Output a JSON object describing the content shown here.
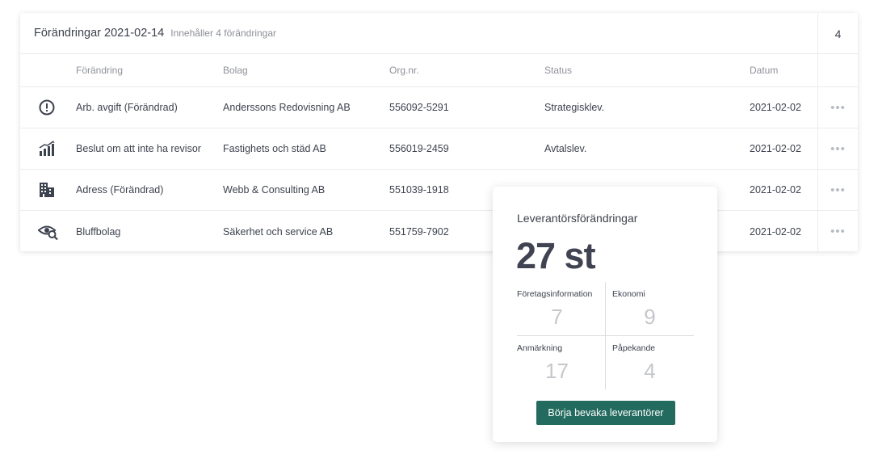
{
  "header": {
    "title": "Förändringar 2021-02-14",
    "subtitle": "Innehåller 4 förändringar",
    "count": "4"
  },
  "columns": {
    "change": "Förändring",
    "company": "Bolag",
    "org": "Org.nr.",
    "status": "Status",
    "date": "Datum"
  },
  "rows": [
    {
      "icon": "alert-circle-icon",
      "change": "Arb. avgift (Förändrad)",
      "company": "Anderssons Redovisning AB",
      "org": "556092-5291",
      "status": "Strategisklev.",
      "date": "2021-02-02",
      "more": "•••"
    },
    {
      "icon": "growth-chart-icon",
      "change": "Beslut om att inte ha revisor",
      "company": "Fastighets och städ AB",
      "org": "556019-2459",
      "status": "Avtalslev.",
      "date": "2021-02-02",
      "more": "•••"
    },
    {
      "icon": "buildings-icon",
      "change": "Adress (Förändrad)",
      "company": "Webb & Consulting AB",
      "org": "551039-1918",
      "status": "",
      "date": "2021-02-02",
      "more": "•••"
    },
    {
      "icon": "eye-search-icon",
      "change": "Bluffbolag",
      "company": "Säkerhet och service AB",
      "org": "551759-7902",
      "status": "",
      "date": "2021-02-02",
      "more": "•••"
    }
  ],
  "popup": {
    "title": "Leverantörsförändringar",
    "total": "27 st",
    "stats": [
      {
        "label": "Företagsinformation",
        "value": "7"
      },
      {
        "label": "Ekonomi",
        "value": "9"
      },
      {
        "label": "Anmärkning",
        "value": "17"
      },
      {
        "label": "Påpekande",
        "value": "4"
      }
    ],
    "button": "Börja bevaka leverantörer"
  },
  "colors": {
    "accent": "#226b5e",
    "text": "#3d4250",
    "muted": "#8e929b"
  }
}
